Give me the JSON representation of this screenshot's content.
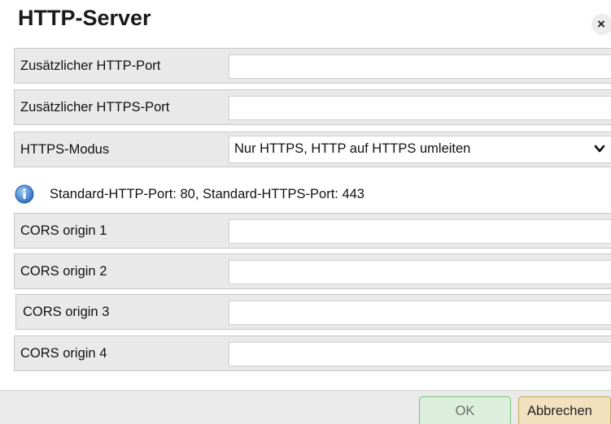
{
  "dialog": {
    "title": "HTTP-Server",
    "close_glyph": "×"
  },
  "fields": [
    {
      "label": "Zusätzlicher HTTP-Port",
      "value": "",
      "placeholder": ""
    },
    {
      "label": "Zusätzlicher HTTPS-Port",
      "value": "",
      "placeholder": ""
    }
  ],
  "https_mode": {
    "label": "HTTPS-Modus",
    "selected": "Nur HTTPS, HTTP auf HTTPS umleiten"
  },
  "info": {
    "text": "Standard-HTTP-Port: 80, Standard-HTTPS-Port: 443",
    "icon": "info-icon"
  },
  "cors": [
    {
      "label": "CORS origin 1",
      "value": ""
    },
    {
      "label": "CORS origin 2",
      "value": ""
    },
    {
      "label": "CORS origin 3",
      "value": ""
    },
    {
      "label": "CORS origin 4",
      "value": ""
    }
  ],
  "footer": {
    "ok_label": "OK",
    "cancel_label": "Abbrechen"
  },
  "colors": {
    "row_background": "#e9e9e9",
    "ok_background": "#dcefdc",
    "ok_border": "#7cc47c",
    "cancel_background": "#f1e1bf",
    "cancel_border": "#c8a85a",
    "info_icon": "#3f7fcf"
  }
}
